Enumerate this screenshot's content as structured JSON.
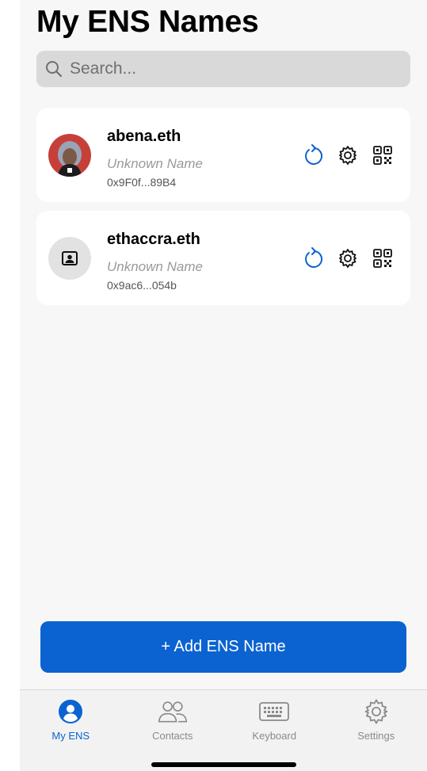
{
  "header": {
    "title": "My ENS Names"
  },
  "search": {
    "placeholder": "Search..."
  },
  "names": [
    {
      "ens": "abena.eth",
      "display_name": "Unknown Name",
      "address": "0x9F0f...89B4",
      "avatar": "photo-avatar"
    },
    {
      "ens": "ethaccra.eth",
      "display_name": "Unknown Name",
      "address": "0x9ac6...054b",
      "avatar": "placeholder-avatar"
    }
  ],
  "add_button": {
    "label": "+ Add ENS Name"
  },
  "tabs": [
    {
      "label": "My ENS",
      "icon": "person-circle-icon",
      "active": true
    },
    {
      "label": "Contacts",
      "icon": "people-icon",
      "active": false
    },
    {
      "label": "Keyboard",
      "icon": "keyboard-icon",
      "active": false
    },
    {
      "label": "Settings",
      "icon": "gear-icon",
      "active": false
    }
  ],
  "colors": {
    "accent": "#0b63d1",
    "background": "#f7f7f7",
    "card": "#ffffff"
  }
}
